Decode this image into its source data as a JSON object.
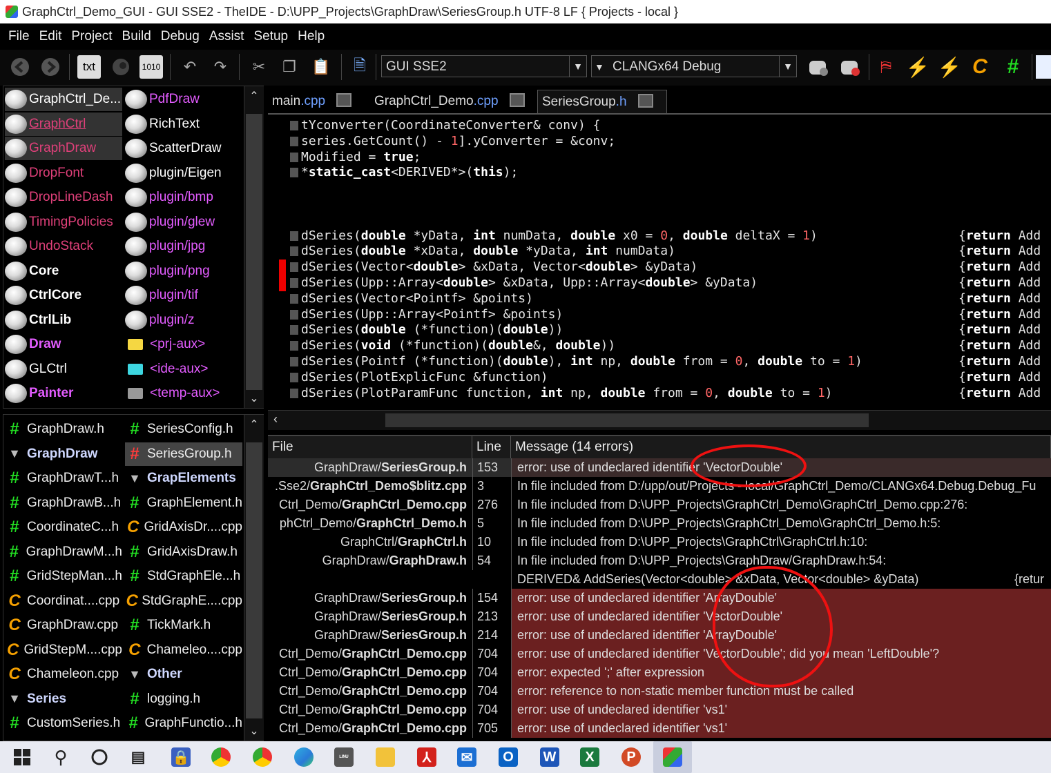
{
  "window": {
    "title": "GraphCtrl_Demo_GUI - GUI SSE2 - TheIDE - D:\\UPP_Projects\\GraphDraw\\SeriesGroup.h UTF-8 LF { Projects - local }"
  },
  "menu": [
    "File",
    "Edit",
    "Project",
    "Build",
    "Debug",
    "Assist",
    "Setup",
    "Help"
  ],
  "toolbar": {
    "txt_label": "txt",
    "bin_label": "1010",
    "build_method": "GUI SSE2",
    "build_config": "CLANGx64 Debug"
  },
  "packages": {
    "left": [
      {
        "label": "GraphCtrl_De...",
        "color": "#ffffff"
      },
      {
        "label": "GraphCtrl",
        "color": "#e0407a"
      },
      {
        "label": "GraphDraw",
        "color": "#e0407a"
      },
      {
        "label": "DropFont",
        "color": "#e0407a"
      },
      {
        "label": "DropLineDash",
        "color": "#e0407a"
      },
      {
        "label": "TimingPolicies",
        "color": "#e0407a"
      },
      {
        "label": "UndoStack",
        "color": "#e0407a"
      },
      {
        "label": "Core",
        "color": "#ffffff"
      },
      {
        "label": "CtrlCore",
        "color": "#ffffff"
      },
      {
        "label": "CtrlLib",
        "color": "#ffffff"
      },
      {
        "label": "Draw",
        "color": "#e35cff"
      },
      {
        "label": "GLCtrl",
        "color": "#ffffff"
      },
      {
        "label": "Painter",
        "color": "#e35cff"
      }
    ],
    "right": [
      {
        "label": "PdfDraw",
        "color": "#e35cff"
      },
      {
        "label": "RichText",
        "color": "#ffffff"
      },
      {
        "label": "ScatterDraw",
        "color": "#ffffff"
      },
      {
        "label": "plugin/Eigen",
        "color": "#ffffff"
      },
      {
        "label": "plugin/bmp",
        "color": "#e35cff"
      },
      {
        "label": "plugin/glew",
        "color": "#e35cff"
      },
      {
        "label": "plugin/jpg",
        "color": "#e35cff"
      },
      {
        "label": "plugin/png",
        "color": "#e35cff"
      },
      {
        "label": "plugin/tif",
        "color": "#e35cff"
      },
      {
        "label": "plugin/z",
        "color": "#e35cff"
      },
      {
        "label": "<prj-aux>",
        "color": "#e35cff"
      },
      {
        "label": "<ide-aux>",
        "color": "#e35cff"
      },
      {
        "label": "<temp-aux>",
        "color": "#e35cff"
      }
    ]
  },
  "files": {
    "left": [
      {
        "label": "GraphDraw.h",
        "icon": "hash-icon",
        "bold": false
      },
      {
        "label": "GraphDraw",
        "icon": "triangle-icon",
        "bold": true
      },
      {
        "label": "GraphDrawT...h",
        "icon": "hash-icon",
        "bold": false
      },
      {
        "label": "GraphDrawB...h",
        "icon": "hash-icon",
        "bold": false
      },
      {
        "label": "CoordinateC...h",
        "icon": "hash-icon",
        "bold": false
      },
      {
        "label": "GraphDrawM...h",
        "icon": "hash-icon",
        "bold": false
      },
      {
        "label": "GridStepMan...h",
        "icon": "hash-icon",
        "bold": false
      },
      {
        "label": "Coordinat....cpp",
        "icon": "cpp-icon",
        "bold": false
      },
      {
        "label": "GraphDraw.cpp",
        "icon": "cpp-icon",
        "bold": false
      },
      {
        "label": "GridStepM....cpp",
        "icon": "cpp-icon",
        "bold": false
      },
      {
        "label": "Chameleon.cpp",
        "icon": "cpp-icon",
        "bold": false
      },
      {
        "label": "Series",
        "icon": "triangle-icon",
        "bold": true
      },
      {
        "label": "CustomSeries.h",
        "icon": "hash-icon",
        "bold": false
      }
    ],
    "right": [
      {
        "label": "SeriesConfig.h",
        "icon": "hash-icon",
        "bold": false
      },
      {
        "label": "SeriesGroup.h",
        "icon": "hash-icon",
        "bold": false
      },
      {
        "label": "GrapElements",
        "icon": "triangle-icon",
        "bold": true
      },
      {
        "label": "GraphElement.h",
        "icon": "hash-icon",
        "bold": false
      },
      {
        "label": "GridAxisDr....cpp",
        "icon": "cpp-icon",
        "bold": false
      },
      {
        "label": "GridAxisDraw.h",
        "icon": "hash-icon",
        "bold": false
      },
      {
        "label": "StdGraphEle...h",
        "icon": "hash-icon",
        "bold": false
      },
      {
        "label": "StdGraphE....cpp",
        "icon": "cpp-icon",
        "bold": false
      },
      {
        "label": "TickMark.h",
        "icon": "hash-icon",
        "bold": false
      },
      {
        "label": "Chameleo....cpp",
        "icon": "cpp-icon",
        "bold": false
      },
      {
        "label": "Other",
        "icon": "triangle-icon",
        "bold": true
      },
      {
        "label": "logging.h",
        "icon": "hash-icon",
        "bold": false
      },
      {
        "label": "GraphFunctio...h",
        "icon": "hash-icon",
        "bold": false
      }
    ]
  },
  "tabs": [
    {
      "name": "main",
      "ext": ".cpp"
    },
    {
      "name": "GraphCtrl_Demo",
      "ext": ".cpp"
    },
    {
      "name": "SeriesGroup",
      "ext": ".h"
    }
  ],
  "code": {
    "lines": [
      "tYconverter(CoordinateConverter& conv) {",
      "series.GetCount() - 1].yConverter = &conv;",
      "Modified = true;",
      "*static_cast<DERIVED*>(this);",
      "",
      "",
      "",
      "dSeries(double *yData, int numData, double x0 = 0, double deltaX = 1)",
      "dSeries(double *xData, double *yData, int numData)",
      "dSeries(Vector<double> &xData, Vector<double> &yData)",
      "dSeries(Upp::Array<double> &xData, Upp::Array<double> &yData)",
      "dSeries(Vector<Pointf> &points)",
      "dSeries(Upp::Array<Pointf> &points)",
      "dSeries(double (*function)(double))",
      "dSeries(void (*function)(double&, double))",
      "dSeries(Pointf (*function)(double), int np, double from = 0, double to = 1)",
      "dSeries(PlotExplicFunc &function)",
      "dSeries(PlotParamFunc function, int np, double from = 0, double to = 1)"
    ],
    "return_text": "{return Add"
  },
  "errors": {
    "columns": {
      "file": "File",
      "line": "Line",
      "message": "Message (14 errors)"
    },
    "rows": [
      {
        "file_prefix": "GraphDraw/",
        "file_bold": "SeriesGroup.h",
        "line": "153",
        "msg": "error: use of undeclared identifier 'VectorDouble'",
        "kind": "err-first"
      },
      {
        "file_prefix": ".Sse2/",
        "file_bold": "GraphCtrl_Demo$blitz.cpp",
        "line": "3",
        "msg": "In file included from D:/upp/out/Projects - local/GraphCtrl_Demo/CLANGx64.Debug.Debug_Fu",
        "kind": "info"
      },
      {
        "file_prefix": "Ctrl_Demo/",
        "file_bold": "GraphCtrl_Demo.cpp",
        "line": "276",
        "msg": "In file included from D:\\UPP_Projects\\GraphCtrl_Demo\\GraphCtrl_Demo.cpp:276:",
        "kind": "info"
      },
      {
        "file_prefix": "phCtrl_Demo/",
        "file_bold": "GraphCtrl_Demo.h",
        "line": "5",
        "msg": "In file included from D:\\UPP_Projects\\GraphCtrl_Demo\\GraphCtrl_Demo.h:5:",
        "kind": "info"
      },
      {
        "file_prefix": "GraphCtrl/",
        "file_bold": "GraphCtrl.h",
        "line": "10",
        "msg": "In file included from D:\\UPP_Projects\\GraphCtrl\\GraphCtrl.h:10:",
        "kind": "info"
      },
      {
        "file_prefix": "GraphDraw/",
        "file_bold": "GraphDraw.h",
        "line": "54",
        "msg": "In file included from D:\\UPP_Projects\\GraphDraw/GraphDraw.h:54:",
        "kind": "info"
      },
      {
        "file_prefix": "",
        "file_bold": "",
        "line": "",
        "msg": "DERIVED& AddSeries(Vector<double> &xData, Vector<double> &yData)",
        "msg_right": "{retur",
        "kind": "info"
      },
      {
        "file_prefix": "GraphDraw/",
        "file_bold": "SeriesGroup.h",
        "line": "154",
        "msg": "error: use of undeclared identifier 'ArrayDouble'",
        "kind": "err"
      },
      {
        "file_prefix": "GraphDraw/",
        "file_bold": "SeriesGroup.h",
        "line": "213",
        "msg": "error: use of undeclared identifier 'VectorDouble'",
        "kind": "err"
      },
      {
        "file_prefix": "GraphDraw/",
        "file_bold": "SeriesGroup.h",
        "line": "214",
        "msg": "error: use of undeclared identifier 'ArrayDouble'",
        "kind": "err"
      },
      {
        "file_prefix": "Ctrl_Demo/",
        "file_bold": "GraphCtrl_Demo.cpp",
        "line": "704",
        "msg": "error: use of undeclared identifier 'VectorDouble'; did you mean 'LeftDouble'?",
        "kind": "err"
      },
      {
        "file_prefix": "Ctrl_Demo/",
        "file_bold": "GraphCtrl_Demo.cpp",
        "line": "704",
        "msg": "error: expected ';' after expression",
        "kind": "err"
      },
      {
        "file_prefix": "Ctrl_Demo/",
        "file_bold": "GraphCtrl_Demo.cpp",
        "line": "704",
        "msg": "error: reference to non-static member function must be called",
        "kind": "err"
      },
      {
        "file_prefix": "Ctrl_Demo/",
        "file_bold": "GraphCtrl_Demo.cpp",
        "line": "704",
        "msg": "error: use of undeclared identifier 'vs1'",
        "kind": "err"
      },
      {
        "file_prefix": "Ctrl_Demo/",
        "file_bold": "GraphCtrl_Demo.cpp",
        "line": "705",
        "msg": "error: use of undeclared identifier 'vs1'",
        "kind": "err"
      }
    ]
  },
  "colors": {
    "error_row": "#6b2020",
    "annotation": "#e11111",
    "file_tab_ext": "#6fa0ff"
  },
  "taskbar": [
    "windows-start-icon",
    "search-icon",
    "task-view-icon",
    "widgets-icon",
    "lock-app-icon",
    "chrome-icon",
    "chrome-dev-icon",
    "edge-icon",
    "terminal-icon",
    "file-explorer-icon",
    "acrobat-icon",
    "mail-icon",
    "outlook-icon",
    "word-icon",
    "excel-icon",
    "powerpoint-icon",
    "theide-icon"
  ]
}
